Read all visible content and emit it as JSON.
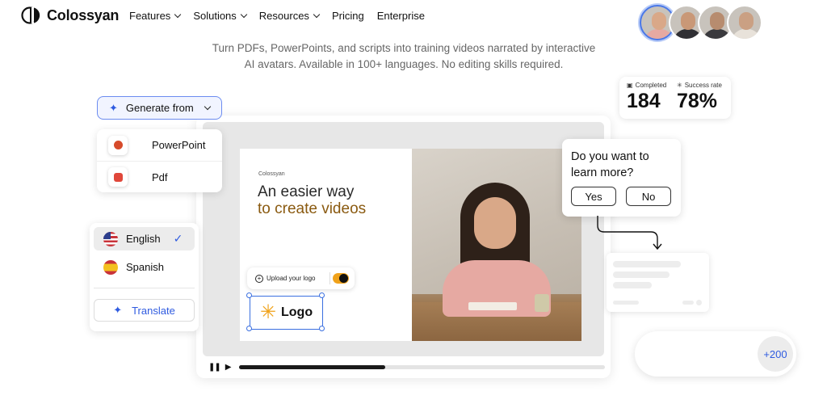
{
  "nav": {
    "logo_text": "Colossyan",
    "items": [
      {
        "label": "Features",
        "has_dropdown": true
      },
      {
        "label": "Solutions",
        "has_dropdown": true
      },
      {
        "label": "Resources",
        "has_dropdown": true
      },
      {
        "label": "Pricing",
        "has_dropdown": false
      },
      {
        "label": "Enterprise",
        "has_dropdown": false
      }
    ]
  },
  "hero": {
    "tagline_line1": "Turn PDFs, PowerPoints, and scripts into training videos narrated by interactive",
    "tagline_line2": "AI avatars. Available in 100+ languages. No editing skills required."
  },
  "generate": {
    "button_label": "Generate from",
    "options": [
      {
        "label": "PowerPoint",
        "icon": "powerpoint-icon"
      },
      {
        "label": "Pdf",
        "icon": "pdf-icon"
      }
    ]
  },
  "stats": {
    "completed_label": "Completed",
    "completed_value": "184",
    "success_label": "Success rate",
    "success_value": "78%"
  },
  "video": {
    "slide_brand": "Colossyan",
    "headline_line1": "An easier way",
    "headline_line2": "to create videos",
    "upload_label": "Upload your logo",
    "logo_placeholder": "Logo",
    "progress": 0.4
  },
  "question": {
    "text_line1": "Do you want to",
    "text_line2": "learn more?",
    "yes": "Yes",
    "no": "No"
  },
  "languages": {
    "items": [
      {
        "label": "English",
        "selected": true
      },
      {
        "label": "Spanish",
        "selected": false
      }
    ],
    "translate_label": "Translate"
  },
  "avatars": {
    "more_label": "+200"
  },
  "colors": {
    "accent_blue": "#2f5be0",
    "brand_orange": "#f0a21a",
    "headline_brown": "#8a5a10"
  }
}
